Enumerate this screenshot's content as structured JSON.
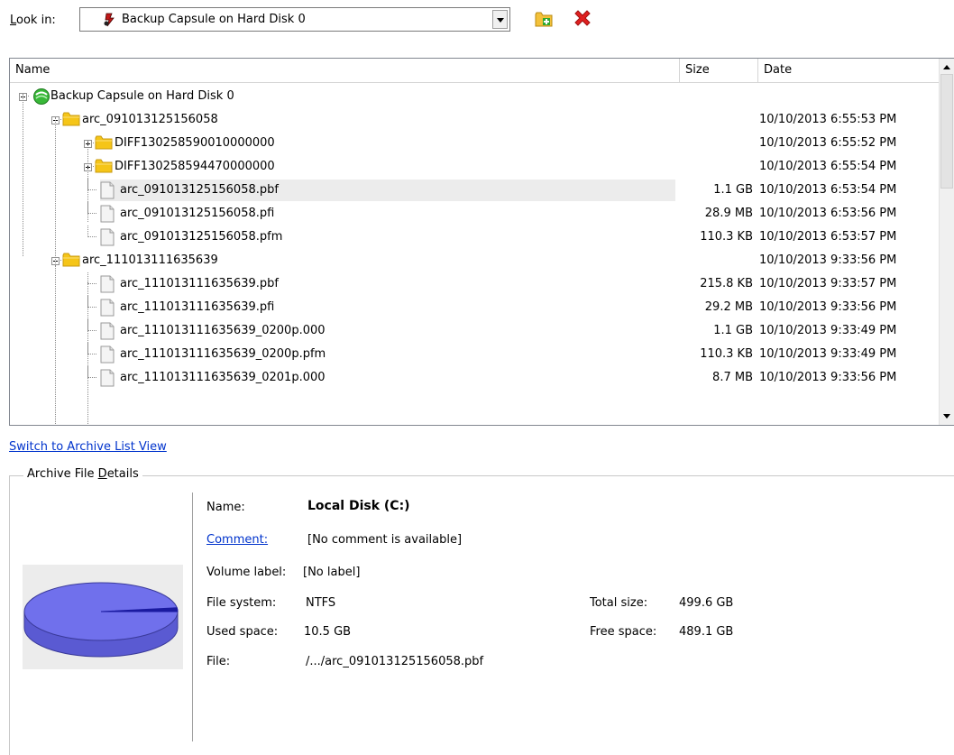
{
  "lookin": {
    "label": "Look in:",
    "label_accel": "L",
    "label_rest": "ook in:",
    "value": "Backup Capsule on Hard Disk 0"
  },
  "toolbar": {
    "new_folder_icon": "new-folder-icon",
    "delete_icon": "delete-icon"
  },
  "columns": {
    "name": "Name",
    "size": "Size",
    "date": "Date"
  },
  "tree": [
    {
      "name": "Backup Capsule on Hard Disk 0",
      "size": "",
      "date": "",
      "type": "capsule",
      "level": 0,
      "expander": "minus"
    },
    {
      "name": "arc_091013125156058",
      "size": "",
      "date": "10/10/2013 6:55:53 PM",
      "type": "folder",
      "level": 1,
      "expander": "minus"
    },
    {
      "name": "DIFF130258590010000000",
      "size": "",
      "date": "10/10/2013 6:55:52 PM",
      "type": "folder",
      "level": 2,
      "expander": "plus"
    },
    {
      "name": "DIFF130258594470000000",
      "size": "",
      "date": "10/10/2013 6:55:54 PM",
      "type": "folder",
      "level": 2,
      "expander": "plus"
    },
    {
      "name": "arc_091013125156058.pbf",
      "size": "1.1 GB",
      "date": "10/10/2013 6:53:54 PM",
      "type": "file",
      "level": 2,
      "selected": true
    },
    {
      "name": "arc_091013125156058.pfi",
      "size": "28.9 MB",
      "date": "10/10/2013 6:53:56 PM",
      "type": "file",
      "level": 2
    },
    {
      "name": "arc_091013125156058.pfm",
      "size": "110.3 KB",
      "date": "10/10/2013 6:53:57 PM",
      "type": "file",
      "level": 2
    },
    {
      "name": "arc_111013111635639",
      "size": "",
      "date": "10/10/2013 9:33:56 PM",
      "type": "folder",
      "level": 1,
      "expander": "minus"
    },
    {
      "name": "arc_111013111635639.pbf",
      "size": "215.8 KB",
      "date": "10/10/2013 9:33:57 PM",
      "type": "file",
      "level": 2
    },
    {
      "name": "arc_111013111635639.pfi",
      "size": "29.2 MB",
      "date": "10/10/2013 9:33:56 PM",
      "type": "file",
      "level": 2
    },
    {
      "name": "arc_111013111635639_0200p.000",
      "size": "1.1 GB",
      "date": "10/10/2013 9:33:49 PM",
      "type": "file",
      "level": 2
    },
    {
      "name": "arc_111013111635639_0200p.pfm",
      "size": "110.3 KB",
      "date": "10/10/2013 9:33:49 PM",
      "type": "file",
      "level": 2
    },
    {
      "name": "arc_111013111635639_0201p.000",
      "size": "8.7 MB",
      "date": "10/10/2013 9:33:56 PM",
      "type": "file",
      "level": 2
    }
  ],
  "switch_link": "Switch to Archive List View",
  "details": {
    "legend": "Archive File Details",
    "legend_pre": "Archive File ",
    "legend_accel": "D",
    "legend_post": "etails",
    "name_label": "Name:",
    "name_value": "Local Disk (C:)",
    "comment_label": "Comment:",
    "comment_value": "[No comment is available]",
    "volume_label_label": "Volume label:",
    "volume_label_value": "[No label]",
    "fs_label": "File system:",
    "fs_value": "NTFS",
    "used_label": "Used space:",
    "used_value": "10.5 GB",
    "file_label": "File:",
    "file_value": "/.../arc_091013125156058.pbf",
    "total_label": "Total size:",
    "total_value": "499.6 GB",
    "free_label": "Free space:",
    "free_value": "489.1 GB",
    "used_fraction": 0.021
  },
  "colors": {
    "link": "#0033cc",
    "folder": "#f5c518",
    "disk": "#6f6fe6",
    "delete": "#e02020"
  }
}
